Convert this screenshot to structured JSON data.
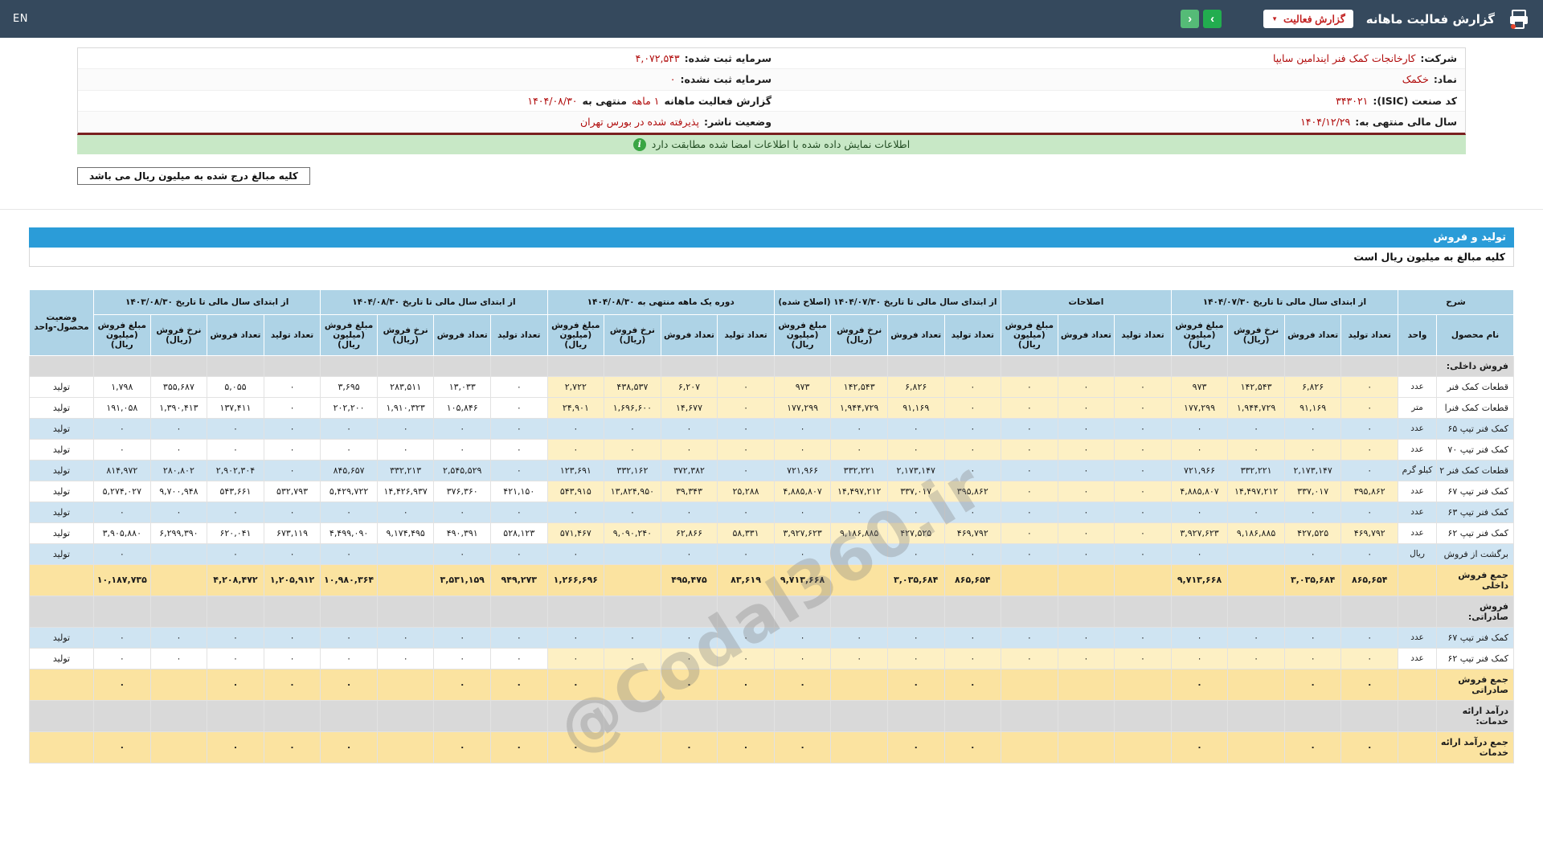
{
  "topbar": {
    "title": "گزارش فعالیت ماهانه",
    "dropdown_label": "گزارش فعالیت",
    "lang": "EN",
    "prev_arrow": "‹",
    "next_arrow": "›"
  },
  "company_info": {
    "rows": [
      {
        "right": [
          {
            "t": "شرکت:",
            "red": false
          },
          {
            "t": "کارخانجات کمک فنر ایندامین سایپا",
            "red": true
          }
        ],
        "left": [
          {
            "t": "سرمایه ثبت شده:",
            "red": false
          },
          {
            "t": "۴,۰۷۲,۵۴۳",
            "red": true
          }
        ]
      },
      {
        "right": [
          {
            "t": "نماد:",
            "red": false
          },
          {
            "t": "خکمک",
            "red": true
          }
        ],
        "left": [
          {
            "t": "سرمایه ثبت نشده:",
            "red": false
          },
          {
            "t": "۰",
            "red": true
          }
        ]
      },
      {
        "right": [
          {
            "t": "کد صنعت (ISIC):",
            "red": false
          },
          {
            "t": "۳۴۳۰۲۱",
            "red": true
          }
        ],
        "left": [
          {
            "t": "گزارش فعالیت ماهانه",
            "red": false
          },
          {
            "t": "۱ ماهه",
            "red": true
          },
          {
            "t": "منتهی به",
            "red": false
          },
          {
            "t": "۱۴۰۴/۰۸/۳۰",
            "red": true
          }
        ]
      },
      {
        "right": [
          {
            "t": "سال مالی منتهی به:",
            "red": false
          },
          {
            "t": "۱۴۰۴/۱۲/۲۹",
            "red": true
          }
        ],
        "left": [
          {
            "t": "وضعیت ناشر:",
            "red": false
          },
          {
            "t": "پذیرفته شده در بورس تهران",
            "red": true
          }
        ]
      }
    ]
  },
  "signed_banner": {
    "text": "اطلاعات نمایش داده شده با اطلاعات امضا شده مطابقت دارد"
  },
  "million_note": "کلیه مبالغ درج شده به میلیون ریال می باشد",
  "section": {
    "title": "تولید و فروش",
    "subtitle": "کلیه مبالغ به میلیون ریال است"
  },
  "watermark": "@Codal360.ir",
  "table": {
    "groups": [
      {
        "label": "شرح",
        "cols": [
          "نام محصول",
          "واحد"
        ]
      },
      {
        "label": "از ابتدای سال مالی تا تاریخ ۱۴۰۴/۰۷/۳۰",
        "cols": [
          "تعداد تولید",
          "تعداد فروش",
          "نرخ فروش (ریال)",
          "مبلغ فروش (میلیون ریال)"
        ]
      },
      {
        "label": "اصلاحات",
        "cols": [
          "تعداد تولید",
          "تعداد فروش",
          "مبلغ فروش (میلیون ریال)"
        ]
      },
      {
        "label": "از ابتدای سال مالی تا تاریخ ۱۴۰۴/۰۷/۳۰ (اصلاح شده)",
        "cols": [
          "تعداد تولید",
          "تعداد فروش",
          "نرخ فروش (ریال)",
          "مبلغ فروش (میلیون ریال)"
        ]
      },
      {
        "label": "دوره یک ماهه منتهی به ۱۴۰۴/۰۸/۳۰",
        "cols": [
          "تعداد تولید",
          "تعداد فروش",
          "نرخ فروش (ریال)",
          "مبلغ فروش (میلیون ریال)"
        ]
      },
      {
        "label": "از ابتدای سال مالی تا تاریخ ۱۴۰۴/۰۸/۳۰",
        "cols": [
          "تعداد تولید",
          "تعداد فروش",
          "نرخ فروش (ریال)",
          "مبلغ فروش (میلیون ریال)"
        ]
      },
      {
        "label": "از ابتدای سال مالی تا تاریخ ۱۴۰۳/۰۸/۳۰",
        "cols": [
          "تعداد تولید",
          "تعداد فروش",
          "نرخ فروش (ریال)",
          "مبلغ فروش (میلیون ریال)"
        ]
      },
      {
        "label": "وضعیت محصول-واحد",
        "cols": []
      }
    ],
    "rows": [
      {
        "tone": "section",
        "name": "فروش داخلی:"
      },
      {
        "tone": "plain",
        "name": "قطعات کمک فنر",
        "unit": "عدد",
        "status": "تولید",
        "v": [
          "۰",
          "۶,۸۲۶",
          "۱۴۲,۵۴۳",
          "۹۷۳",
          "۰",
          "۰",
          "۰",
          "۰",
          "۶,۸۲۶",
          "۱۴۲,۵۴۳",
          "۹۷۳",
          "۰",
          "۶,۲۰۷",
          "۴۳۸,۵۳۷",
          "۲,۷۲۲",
          "۰",
          "۱۳,۰۳۳",
          "۲۸۳,۵۱۱",
          "۳,۶۹۵",
          "۰",
          "۵,۰۵۵",
          "۳۵۵,۶۸۷",
          "۱,۷۹۸"
        ]
      },
      {
        "tone": "plain",
        "name": "قطعات کمک فنرا",
        "unit": "متر",
        "status": "تولید",
        "v": [
          "۰",
          "۹۱,۱۶۹",
          "۱,۹۴۴,۷۲۹",
          "۱۷۷,۲۹۹",
          "۰",
          "۰",
          "۰",
          "۰",
          "۹۱,۱۶۹",
          "۱,۹۴۴,۷۲۹",
          "۱۷۷,۲۹۹",
          "۰",
          "۱۴,۶۷۷",
          "۱,۶۹۶,۶۰۰",
          "۲۴,۹۰۱",
          "۰",
          "۱۰۵,۸۴۶",
          "۱,۹۱۰,۳۲۳",
          "۲۰۲,۲۰۰",
          "۰",
          "۱۳۷,۴۱۱",
          "۱,۳۹۰,۴۱۳",
          "۱۹۱,۰۵۸"
        ]
      },
      {
        "tone": "blue",
        "name": "کمک فنر تیپ ۶۵",
        "unit": "عدد",
        "status": "تولید",
        "v": [
          "۰",
          "۰",
          "۰",
          "۰",
          "۰",
          "۰",
          "۰",
          "۰",
          "۰",
          "۰",
          "۰",
          "۰",
          "۰",
          "۰",
          "۰",
          "۰",
          "۰",
          "۰",
          "۰",
          "۰",
          "۰",
          "۰",
          "۰"
        ]
      },
      {
        "tone": "plain",
        "name": "کمک فنر تیپ ۷۰",
        "unit": "عدد",
        "status": "تولید",
        "v": [
          "۰",
          "۰",
          "۰",
          "۰",
          "۰",
          "۰",
          "۰",
          "۰",
          "۰",
          "۰",
          "۰",
          "۰",
          "۰",
          "۰",
          "۰",
          "۰",
          "۰",
          "۰",
          "۰",
          "۰",
          "۰",
          "۰",
          "۰"
        ]
      },
      {
        "tone": "blue",
        "name": "قطعات کمک فنر ۲",
        "unit": "کیلو گرم",
        "status": "تولید",
        "v": [
          "۰",
          "۲,۱۷۳,۱۴۷",
          "۳۳۲,۲۲۱",
          "۷۲۱,۹۶۶",
          "۰",
          "۰",
          "۰",
          "۰",
          "۲,۱۷۳,۱۴۷",
          "۳۳۲,۲۲۱",
          "۷۲۱,۹۶۶",
          "۰",
          "۳۷۲,۳۸۲",
          "۳۳۲,۱۶۲",
          "۱۲۳,۶۹۱",
          "۰",
          "۲,۵۴۵,۵۲۹",
          "۳۳۲,۲۱۳",
          "۸۴۵,۶۵۷",
          "۰",
          "۲,۹۰۲,۳۰۴",
          "۲۸۰,۸۰۲",
          "۸۱۴,۹۷۲"
        ]
      },
      {
        "tone": "plain",
        "name": "کمک فنر تیپ ۶۷",
        "unit": "عدد",
        "status": "تولید",
        "v": [
          "۳۹۵,۸۶۲",
          "۳۳۷,۰۱۷",
          "۱۴,۴۹۷,۲۱۲",
          "۴,۸۸۵,۸۰۷",
          "۰",
          "۰",
          "۰",
          "۳۹۵,۸۶۲",
          "۳۳۷,۰۱۷",
          "۱۴,۴۹۷,۲۱۲",
          "۴,۸۸۵,۸۰۷",
          "۲۵,۲۸۸",
          "۳۹,۳۴۳",
          "۱۳,۸۲۴,۹۵۰",
          "۵۴۳,۹۱۵",
          "۴۲۱,۱۵۰",
          "۳۷۶,۳۶۰",
          "۱۴,۴۲۶,۹۳۷",
          "۵,۴۲۹,۷۲۲",
          "۵۳۲,۷۹۳",
          "۵۴۳,۶۶۱",
          "۹,۷۰۰,۹۴۸",
          "۵,۲۷۴,۰۲۷"
        ]
      },
      {
        "tone": "blue",
        "name": "کمک فنر تیپ ۶۳",
        "unit": "عدد",
        "status": "تولید",
        "v": [
          "۰",
          "۰",
          "۰",
          "۰",
          "۰",
          "۰",
          "۰",
          "۰",
          "۰",
          "۰",
          "۰",
          "۰",
          "۰",
          "۰",
          "۰",
          "۰",
          "۰",
          "۰",
          "۰",
          "۰",
          "۰",
          "۰",
          "۰"
        ]
      },
      {
        "tone": "plain",
        "name": "کمک فنر تیپ ۶۲",
        "unit": "عدد",
        "status": "تولید",
        "v": [
          "۴۶۹,۷۹۲",
          "۴۲۷,۵۲۵",
          "۹,۱۸۶,۸۸۵",
          "۳,۹۲۷,۶۲۳",
          "۰",
          "۰",
          "۰",
          "۴۶۹,۷۹۲",
          "۴۲۷,۵۲۵",
          "۹,۱۸۶,۸۸۵",
          "۳,۹۲۷,۶۲۳",
          "۵۸,۳۳۱",
          "۶۲,۸۶۶",
          "۹,۰۹۰,۲۴۰",
          "۵۷۱,۴۶۷",
          "۵۲۸,۱۲۳",
          "۴۹۰,۳۹۱",
          "۹,۱۷۴,۴۹۵",
          "۴,۴۹۹,۰۹۰",
          "۶۷۳,۱۱۹",
          "۶۲۰,۰۴۱",
          "۶,۲۹۹,۳۹۰",
          "۳,۹۰۵,۸۸۰"
        ]
      },
      {
        "tone": "blue",
        "name": "برگشت از فروش",
        "unit": "ریال",
        "status": "تولید",
        "v": [
          "۰",
          "۰",
          "",
          "۰",
          "۰",
          "۰",
          "۰",
          "۰",
          "۰",
          "",
          "۰",
          "۰",
          "۰",
          "",
          "۰",
          "۰",
          "۰",
          "",
          "۰",
          "۰",
          "۰",
          "",
          "۰"
        ]
      },
      {
        "tone": "total",
        "name": "جمع فروش داخلی",
        "unit": "",
        "status": "",
        "v": [
          "۸۶۵,۶۵۴",
          "۳,۰۳۵,۶۸۴",
          "",
          "۹,۷۱۳,۶۶۸",
          "",
          "",
          "",
          "۸۶۵,۶۵۴",
          "۳,۰۳۵,۶۸۴",
          "",
          "۹,۷۱۳,۶۶۸",
          "۸۳,۶۱۹",
          "۴۹۵,۴۷۵",
          "",
          "۱,۲۶۶,۶۹۶",
          "۹۴۹,۲۷۳",
          "۳,۵۳۱,۱۵۹",
          "",
          "۱۰,۹۸۰,۳۶۴",
          "۱,۲۰۵,۹۱۲",
          "۴,۲۰۸,۴۷۲",
          "",
          "۱۰,۱۸۷,۷۳۵"
        ]
      },
      {
        "tone": "section",
        "name": "فروش صادراتی:"
      },
      {
        "tone": "blue",
        "name": "کمک فنر تیپ ۶۷",
        "unit": "عدد",
        "status": "تولید",
        "v": [
          "۰",
          "۰",
          "۰",
          "۰",
          "۰",
          "۰",
          "۰",
          "۰",
          "۰",
          "۰",
          "۰",
          "۰",
          "۰",
          "۰",
          "۰",
          "۰",
          "۰",
          "۰",
          "۰",
          "۰",
          "۰",
          "۰",
          "۰"
        ]
      },
      {
        "tone": "plain",
        "name": "کمک فنر تیپ ۶۲",
        "unit": "عدد",
        "status": "تولید",
        "v": [
          "۰",
          "۰",
          "۰",
          "۰",
          "۰",
          "۰",
          "۰",
          "۰",
          "۰",
          "۰",
          "۰",
          "۰",
          "۰",
          "۰",
          "۰",
          "۰",
          "۰",
          "۰",
          "۰",
          "۰",
          "۰",
          "۰",
          "۰"
        ]
      },
      {
        "tone": "total",
        "name": "جمع فروش صادراتی",
        "unit": "",
        "status": "",
        "v": [
          "۰",
          "۰",
          "",
          "۰",
          "",
          "",
          "",
          "۰",
          "۰",
          "",
          "۰",
          "۰",
          "۰",
          "",
          "۰",
          "۰",
          "۰",
          "",
          "۰",
          "۰",
          "۰",
          "",
          "۰"
        ]
      },
      {
        "tone": "section",
        "name": "درآمد ارائه خدمات:"
      },
      {
        "tone": "total",
        "name": "جمع درآمد ارائه خدمات",
        "unit": "",
        "status": "",
        "v": [
          "۰",
          "۰",
          "",
          "۰",
          "",
          "",
          "",
          "۰",
          "۰",
          "",
          "۰",
          "۰",
          "۰",
          "",
          "۰",
          "۰",
          "۰",
          "",
          "۰",
          "۰",
          "۰",
          "",
          "۰"
        ]
      }
    ]
  }
}
